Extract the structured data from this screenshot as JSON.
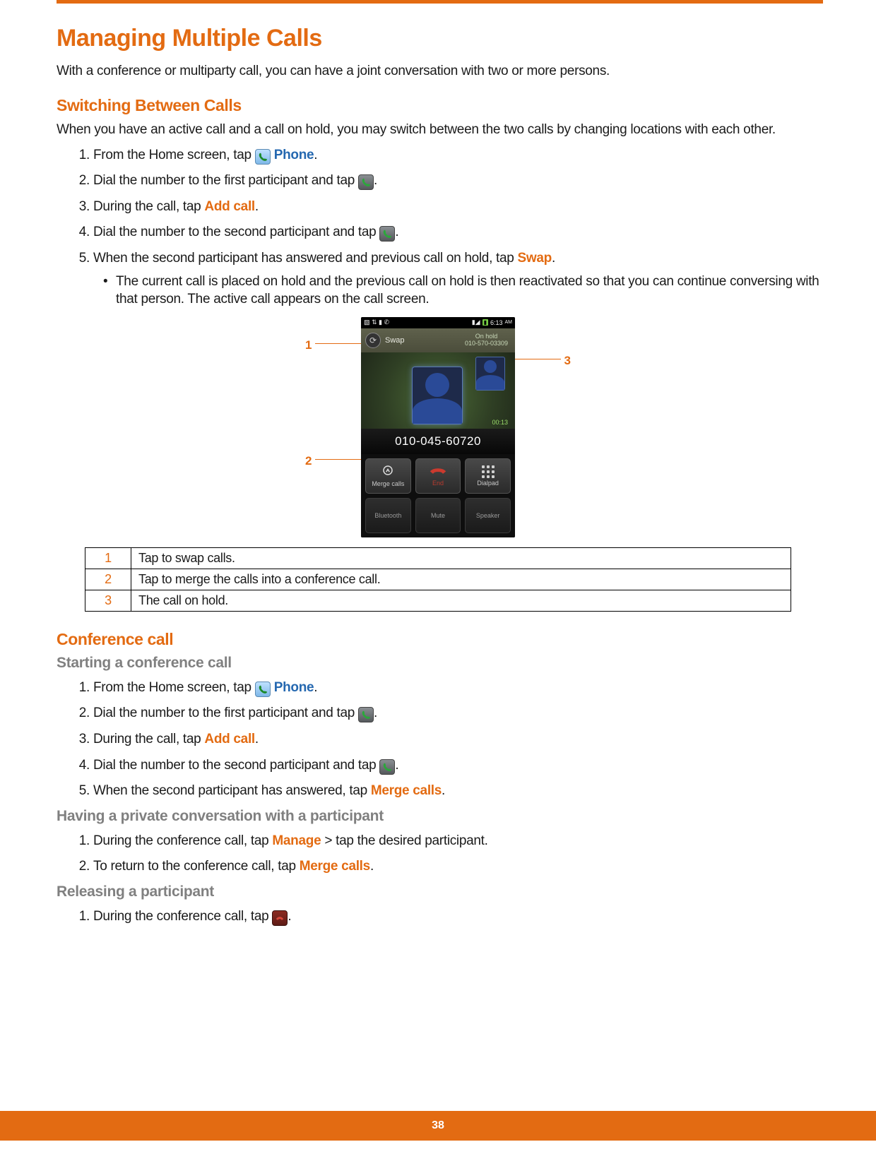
{
  "page_number": "38",
  "title": "Managing Multiple Calls",
  "intro": "With a conference or multiparty call, you can have a joint conversation with two or more persons.",
  "sec_switch": {
    "heading": "Switching Between Calls",
    "para": "When you have an active call and a call on hold, you may switch between the two calls by changing locations with each other.",
    "s1a": "From the Home screen, tap ",
    "s1b": "Phone",
    "s1c": ".",
    "s2a": "Dial the number to the first participant and tap ",
    "s2b": ".",
    "s3a": "During the call, tap ",
    "s3b": "Add call",
    "s3c": ".",
    "s4a": "Dial the number to the second participant and tap ",
    "s4b": ".",
    "s5a": "When the second participant has answered and previous call on hold, tap ",
    "s5b": "Swap",
    "s5c": ".",
    "bullet": "The current call is placed on hold and the previous call on hold is then reactivated so that you can continue conversing with that person. The active call appears on the call screen."
  },
  "figure": {
    "time": "6:13",
    "ampm": "AM",
    "swap": "Swap",
    "onhold": "On hold",
    "hold_num": "010-570-03309",
    "timer": "00:13",
    "active_num": "010-045-60720",
    "btn_merge": "Merge calls",
    "btn_end": "End",
    "btn_dialpad": "Dialpad",
    "btn_bt": "Bluetooth",
    "btn_mute": "Mute",
    "btn_speaker": "Speaker",
    "c1": "1",
    "c2": "2",
    "c3": "3"
  },
  "legend": {
    "r1i": "1",
    "r1": "Tap to swap calls.",
    "r2i": "2",
    "r2": "Tap to merge the calls into a conference call.",
    "r3i": "3",
    "r3": "The call on hold."
  },
  "sec_conf": {
    "heading": "Conference call",
    "start_h": "Starting a conference call",
    "s1a": "From the Home screen, tap ",
    "s1b": "Phone",
    "s1c": ".",
    "s2a": "Dial the number to the first participant and tap ",
    "s2b": ".",
    "s3a": "During the call, tap ",
    "s3b": "Add call",
    "s3c": ".",
    "s4a": "Dial the number to the second participant and tap ",
    "s4b": ".",
    "s5a": "When the second participant has answered, tap ",
    "s5b": "Merge calls",
    "s5c": ".",
    "priv_h": "Having a private conversation with a participant",
    "p1a": "During the conference call, tap ",
    "p1b": "Manage",
    "p1c": " > tap the desired participant.",
    "p2a": "To return to the conference call, tap ",
    "p2b": "Merge calls",
    "p2c": ".",
    "rel_h": "Releasing a participant",
    "r1a": "During the conference call, tap ",
    "r1b": "."
  }
}
